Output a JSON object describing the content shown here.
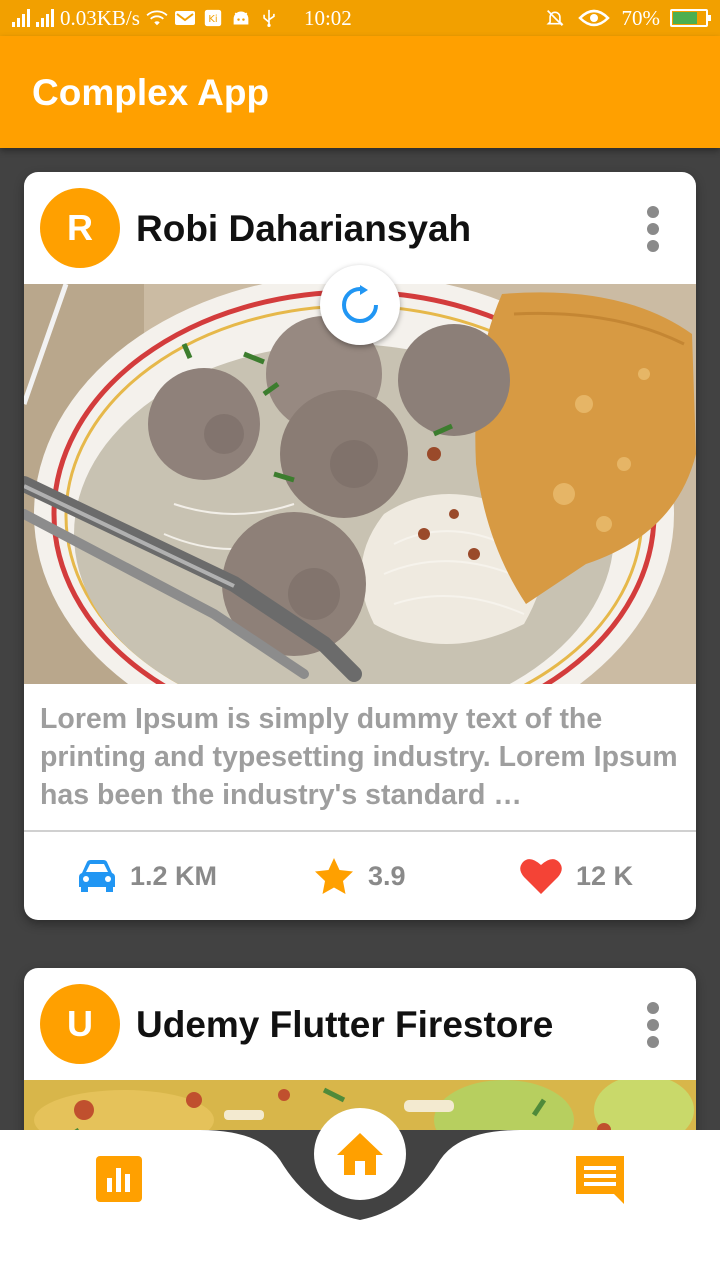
{
  "status_bar": {
    "network_speed": "0.03KB/s",
    "time": "10:02",
    "battery_percent": "70%",
    "battery_level": 0.7,
    "icons": [
      "signal-icon",
      "signal-icon",
      "wifi-icon",
      "mail-icon",
      "app-icon",
      "android-icon",
      "usb-icon",
      "mute-icon",
      "eye-icon",
      "battery-icon"
    ]
  },
  "app_bar": {
    "title": "Complex App"
  },
  "cards": [
    {
      "avatar_letter": "R",
      "author": "Robi Dahariansyah",
      "description": "Lorem Ipsum is simply dummy text of the printing and typesetting industry. Lorem Ipsum has been the industry's standard …",
      "stats": {
        "distance": "1.2 KM",
        "rating": "3.9",
        "likes": "12 K"
      }
    },
    {
      "avatar_letter": "U",
      "author": "Udemy Flutter Firestore"
    }
  ],
  "bottom_nav": {
    "items": [
      "bar-chart-icon",
      "home-icon",
      "chat-icon"
    ],
    "active": "home-icon"
  },
  "colors": {
    "primary": "#ffa000",
    "car_icon": "#2196f3",
    "star_icon": "#ffa000",
    "heart_icon": "#f44336",
    "loader": "#2196f3"
  }
}
